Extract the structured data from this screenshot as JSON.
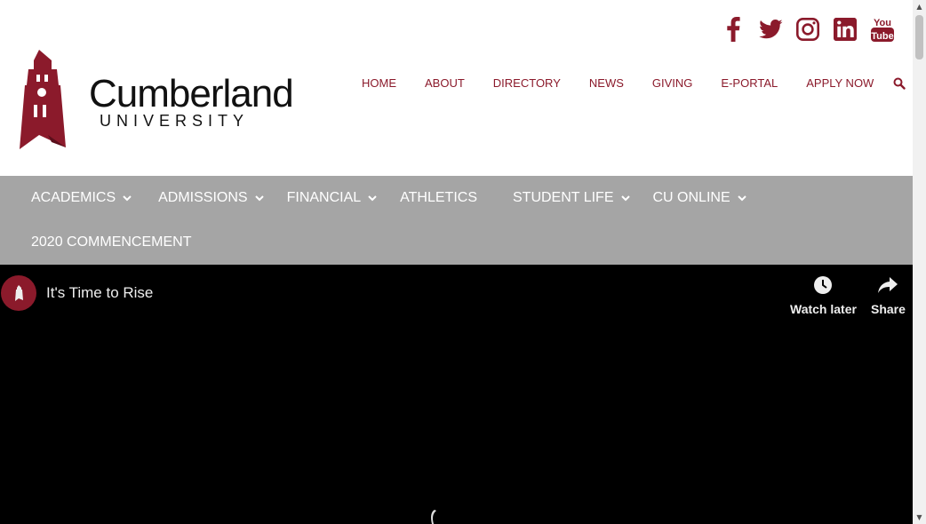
{
  "header": {
    "logo": {
      "name": "Cumberland",
      "subtitle": "UNIVERSITY"
    },
    "social": [
      {
        "icon": "facebook-icon"
      },
      {
        "icon": "twitter-icon"
      },
      {
        "icon": "instagram-icon"
      },
      {
        "icon": "linkedin-icon"
      },
      {
        "icon": "youtube-icon",
        "text_top": "You",
        "text_bottom": "Tube"
      }
    ],
    "topnav": [
      "HOME",
      "ABOUT",
      "DIRECTORY",
      "NEWS",
      "GIVING",
      "E-PORTAL",
      "APPLY NOW"
    ],
    "colors": {
      "brand": "#8b1a2b",
      "nav_bg": "#a5a5a5"
    }
  },
  "mainnav": {
    "row1": [
      "ACADEMICS",
      "ADMISSIONS",
      "FINANCIAL",
      "ATHLETICS",
      "STUDENT LIFE",
      "CU ONLINE"
    ],
    "row2": [
      "2020 COMMENCEMENT"
    ]
  },
  "video": {
    "title": "It's Time to Rise",
    "watch_later": "Watch later",
    "share": "Share"
  }
}
